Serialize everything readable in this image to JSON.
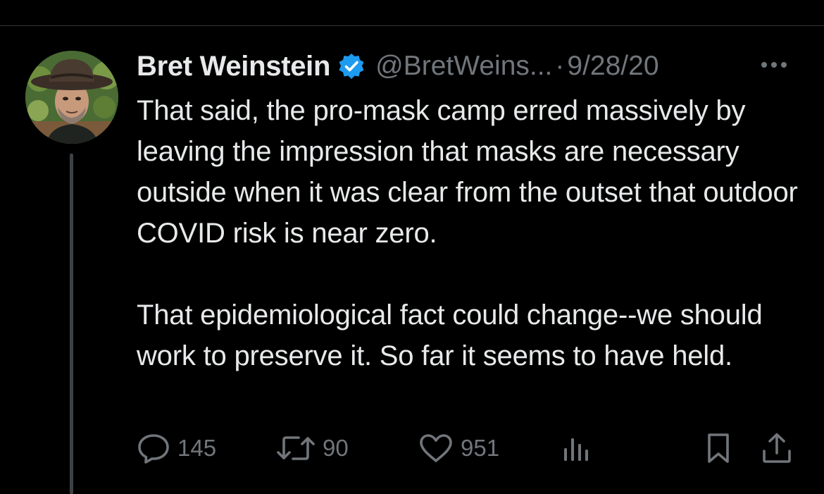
{
  "tweet": {
    "author_name": "Bret Weinstein",
    "verified": true,
    "handle": "@BretWeins...",
    "separator": "·",
    "timestamp": "9/28/20",
    "paragraphs": [
      "That said, the pro-mask camp erred massively by leaving the impression that masks are necessary outside when it was clear from the outset that outdoor COVID risk is near zero.",
      "That epidemiological fact could change--we should work to preserve it. So far it seems to have held."
    ],
    "metrics": {
      "replies": "145",
      "retweets": "90",
      "likes": "951"
    }
  },
  "icons": {
    "reply": "reply-bubble-icon",
    "retweet": "retweet-icon",
    "like": "heart-icon",
    "views": "views-bar-chart-icon",
    "bookmark": "bookmark-icon",
    "share": "share-upload-icon",
    "more": "more-dots-icon",
    "verified": "verified-badge-icon"
  },
  "colors": {
    "background": "#000000",
    "text_primary": "#e7e9ea",
    "text_secondary": "#71767b",
    "verified_blue": "#1d9bf0",
    "divider": "#2f3336"
  }
}
